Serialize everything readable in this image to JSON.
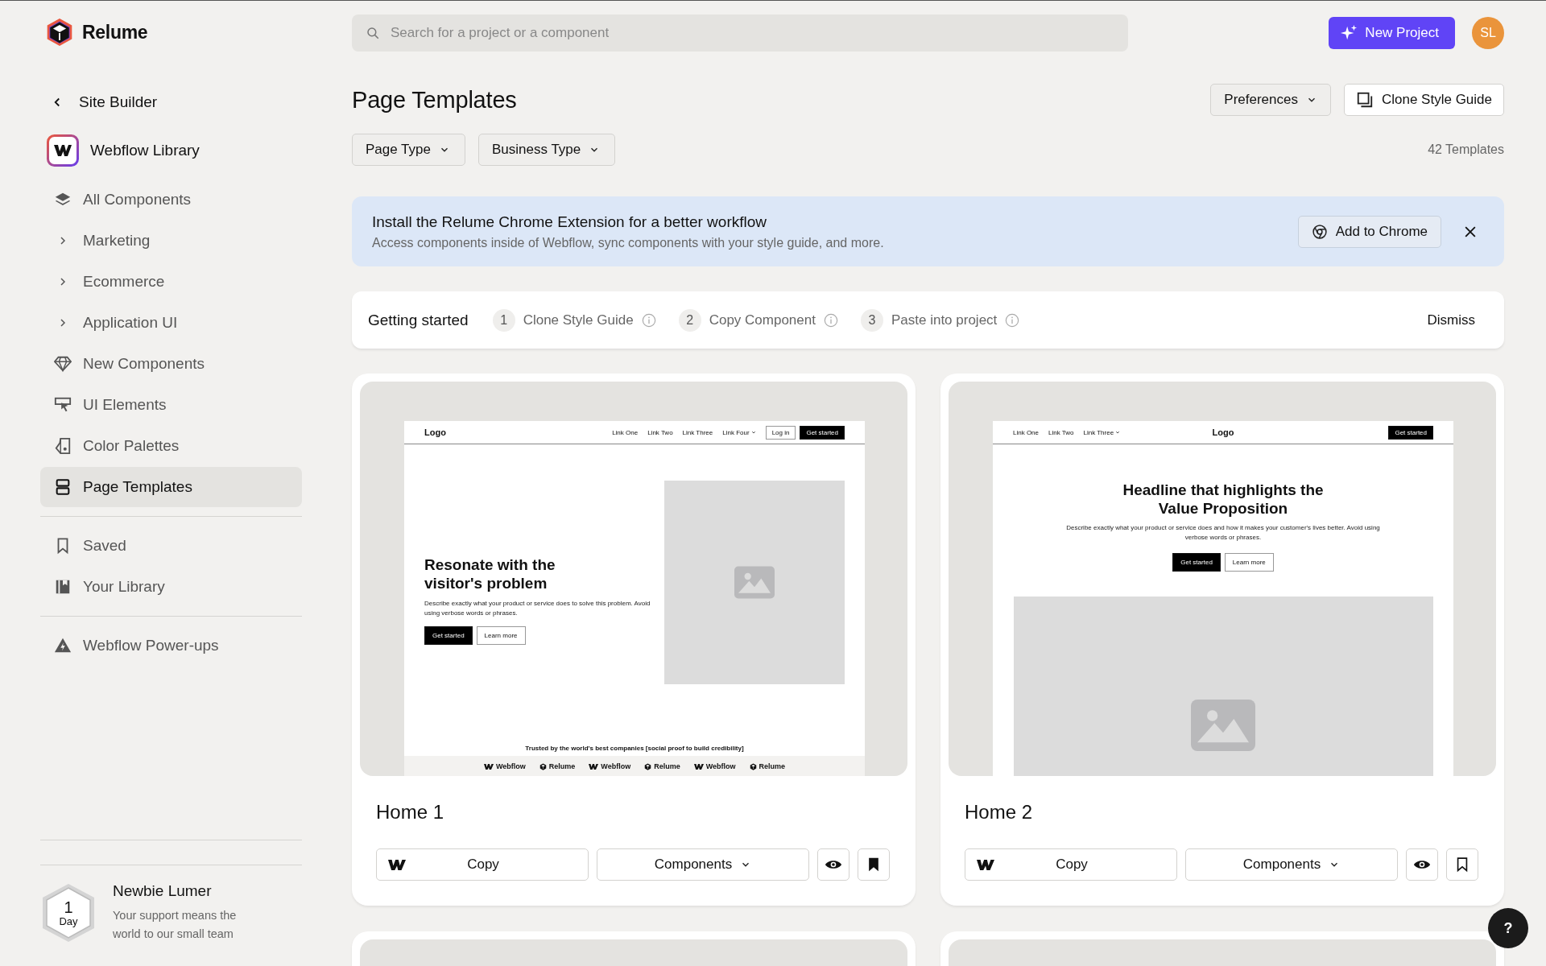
{
  "brand": {
    "name": "Relume"
  },
  "sidebar": {
    "back_link": {
      "label": "Site Builder"
    },
    "library": {
      "label": "Webflow Library"
    },
    "nav_items": [
      {
        "label": "All Components",
        "kind": "icon",
        "selected": false
      },
      {
        "label": "Marketing",
        "kind": "expandable",
        "selected": false
      },
      {
        "label": "Ecommerce",
        "kind": "expandable",
        "selected": false
      },
      {
        "label": "Application UI",
        "kind": "expandable",
        "selected": false
      },
      {
        "label": "New Components",
        "kind": "icon",
        "selected": false
      },
      {
        "label": "UI Elements",
        "kind": "icon",
        "selected": false
      },
      {
        "label": "Color Palettes",
        "kind": "icon",
        "selected": false
      },
      {
        "label": "Page Templates",
        "kind": "icon",
        "selected": true
      }
    ],
    "saved_items": [
      {
        "label": "Saved",
        "selected": false
      },
      {
        "label": "Your Library",
        "selected": false
      }
    ],
    "extra_items": [
      {
        "label": "Webflow Power-ups",
        "selected": false
      }
    ],
    "promo": {
      "badge_number": "1",
      "badge_unit": "Day",
      "title": "Newbie Lumer",
      "text": "Your support means the world to our small team"
    }
  },
  "topbar": {
    "search": {
      "placeholder": "Search for a project or a component"
    },
    "new_project": {
      "label": "New Project"
    },
    "avatar": {
      "initials": "SL"
    }
  },
  "page": {
    "title": "Page Templates",
    "actions": [
      {
        "label": "Preferences",
        "kind": "dropdown"
      },
      {
        "label": "Clone Style Guide",
        "kind": "copy"
      }
    ],
    "filters": [
      {
        "label": "Page Type"
      },
      {
        "label": "Business Type"
      }
    ],
    "count": "42 Templates"
  },
  "banner": {
    "title": "Install the Relume Chrome Extension for a better workflow",
    "text": "Access components inside of Webflow, sync components with your style guide, and more.",
    "button": {
      "label": "Add to Chrome"
    }
  },
  "getting_started": {
    "title": "Getting started",
    "steps": [
      {
        "number": "1",
        "label": "Clone Style Guide"
      },
      {
        "number": "2",
        "label": "Copy Component"
      },
      {
        "number": "3",
        "label": "Paste into project"
      }
    ],
    "dismiss": {
      "label": "Dismiss"
    }
  },
  "templates": [
    {
      "name": "Home 1",
      "saved": true,
      "copy_label": "Copy",
      "components_label": "Components",
      "preview": {
        "kind": "split",
        "logo": "Logo",
        "links": [
          {
            "label": "Link One",
            "dropdown": false
          },
          {
            "label": "Link Two",
            "dropdown": false
          },
          {
            "label": "Link Three",
            "dropdown": false
          },
          {
            "label": "Link Four",
            "dropdown": true
          }
        ],
        "nav_buttons": [
          {
            "label": "Log in",
            "kind": "outline"
          },
          {
            "label": "Get started",
            "kind": "solid"
          }
        ],
        "headline": "Resonate with the visitor's problem",
        "text": "Describe exactly what your product or service does to solve this problem. Avoid using verbose words or phrases.",
        "cta": [
          {
            "label": "Get started",
            "kind": "solid"
          },
          {
            "label": "Learn more",
            "kind": "outline"
          }
        ],
        "logos_title": "Trusted by the world's best companies [social proof to build credibility]",
        "logos": [
          {
            "label": "Webflow",
            "kind": "w"
          },
          {
            "label": "Relume",
            "kind": "cube"
          },
          {
            "label": "Webflow",
            "kind": "w"
          },
          {
            "label": "Relume",
            "kind": "cube"
          },
          {
            "label": "Webflow",
            "kind": "w"
          },
          {
            "label": "Relume",
            "kind": "cube"
          }
        ]
      }
    },
    {
      "name": "Home 2",
      "saved": false,
      "copy_label": "Copy",
      "components_label": "Components",
      "preview": {
        "kind": "centered",
        "logo": "Logo",
        "links": [
          {
            "label": "Link One",
            "dropdown": false
          },
          {
            "label": "Link Two",
            "dropdown": false
          },
          {
            "label": "Link Three",
            "dropdown": true
          }
        ],
        "nav_buttons": [
          {
            "label": "Get started",
            "kind": "solid"
          }
        ],
        "headline": "Headline that highlights the Value Proposition",
        "text": "Describe exactly what your product or service does and how it makes your customer's lives better. Avoid using verbose words or phrases.",
        "cta": [
          {
            "label": "Get started",
            "kind": "solid"
          },
          {
            "label": "Learn more",
            "kind": "outline"
          }
        ]
      }
    },
    {
      "preview": {
        "kind": "blank"
      }
    },
    {
      "preview": {
        "kind": "blank"
      }
    }
  ],
  "help": {
    "label": "?"
  }
}
